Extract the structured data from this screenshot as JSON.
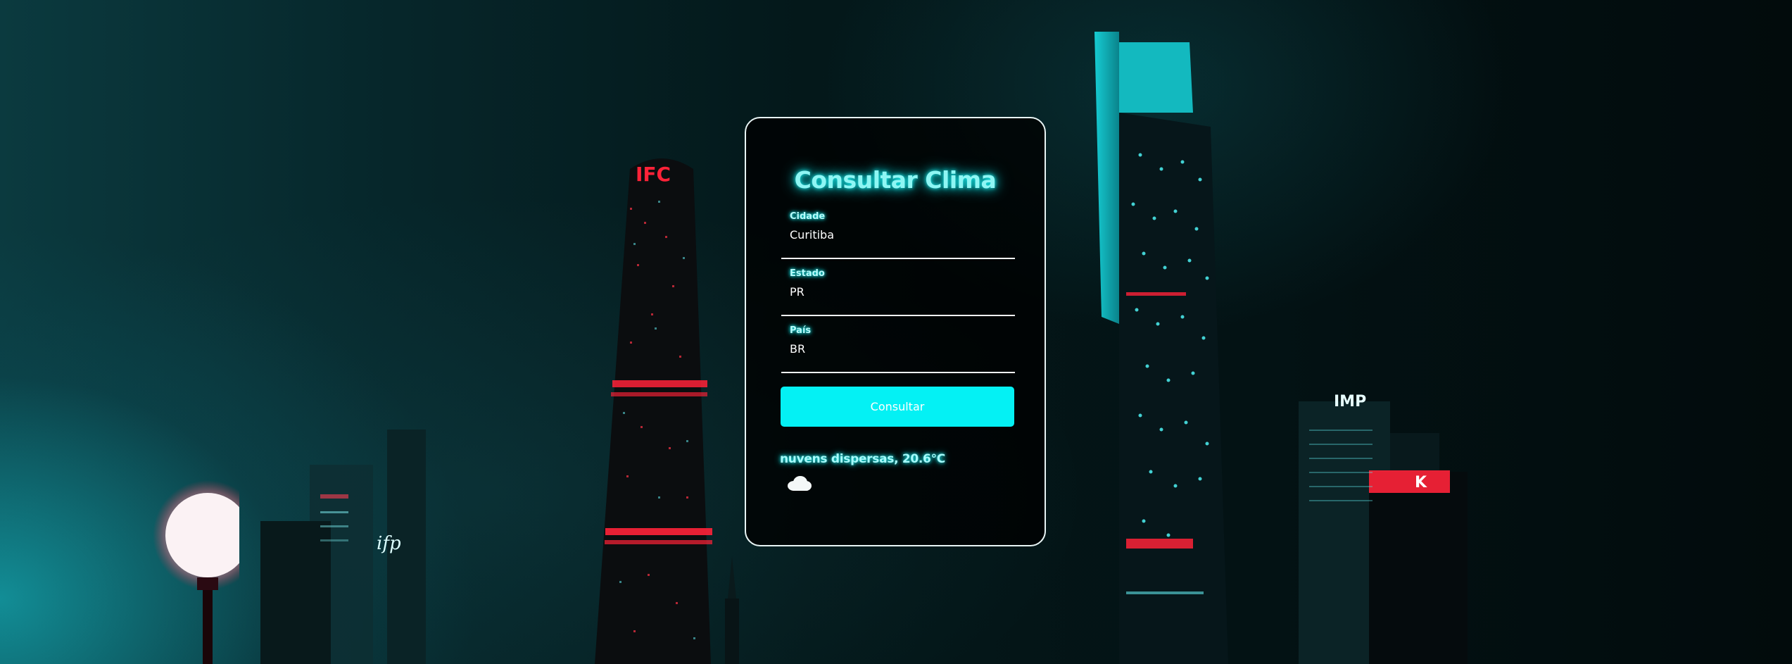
{
  "form": {
    "title": "Consultar Clima",
    "fields": [
      {
        "label": "Cidade",
        "value": "Curitiba"
      },
      {
        "label": "Estado",
        "value": "PR"
      },
      {
        "label": "País",
        "value": "BR"
      }
    ],
    "submit_label": "Consultar"
  },
  "result": {
    "text": "nuvens dispersas, 20.6°C",
    "icon": "cloud-icon"
  },
  "background": {
    "signs": [
      "IFC",
      "ifp",
      "IMP"
    ]
  },
  "colors": {
    "accent": "#04f1f4",
    "neon_text": "#8ef6f4",
    "card_border": "#e8f4f4",
    "background": "#041214",
    "neon_red": "#ff2238"
  }
}
